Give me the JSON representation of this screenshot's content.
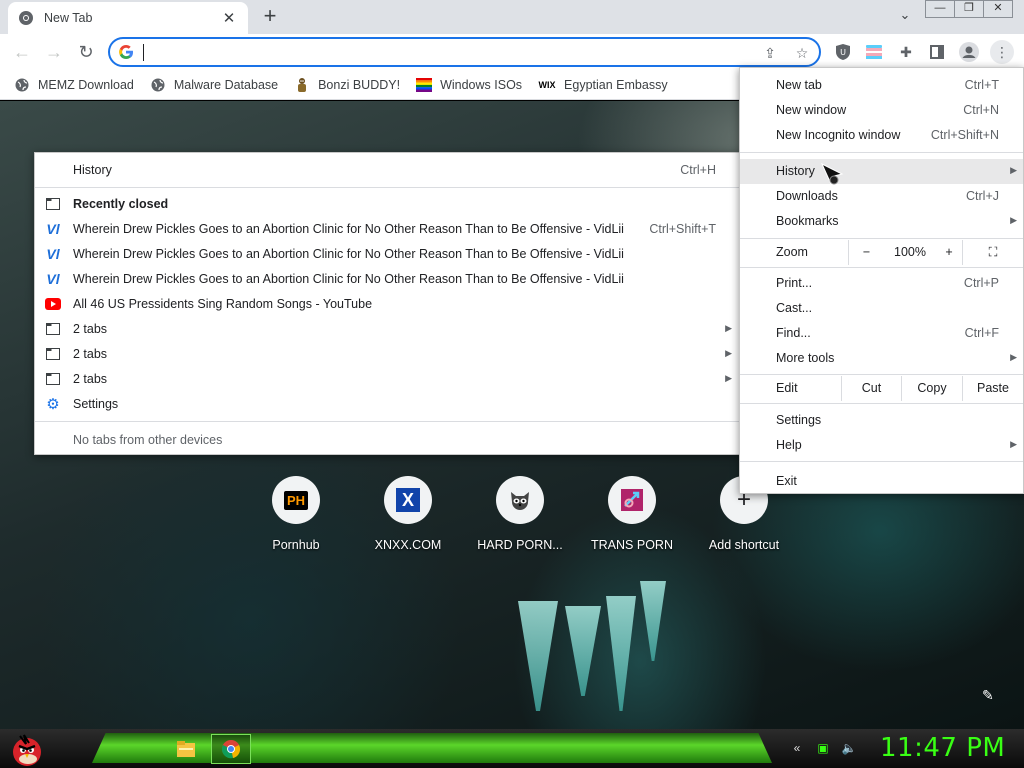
{
  "tab": {
    "title": "New Tab",
    "close": "✕",
    "new": "+"
  },
  "window": {
    "minimize": "—",
    "restore": "❐",
    "close": "✕",
    "dropdown": "⌄"
  },
  "omnibox": {
    "value": "",
    "placeholder": ""
  },
  "bookmarks": [
    {
      "label": "MEMZ Download",
      "icon": "globe-icon"
    },
    {
      "label": "Malware Database",
      "icon": "globe-icon"
    },
    {
      "label": "Bonzi BUDDY!",
      "icon": "bonzi-icon"
    },
    {
      "label": "Windows ISOs",
      "icon": "windows-icon"
    },
    {
      "label": "Egyptian Embassy",
      "icon": "wix-icon"
    }
  ],
  "history_menu": {
    "header": {
      "label": "History",
      "shortcut": "Ctrl+H"
    },
    "recently_closed": "Recently closed",
    "items": [
      {
        "label": "Wherein Drew Pickles Goes to an Abortion Clinic for No Other Reason Than to Be Offensive - VidLii",
        "shortcut": "Ctrl+Shift+T",
        "icon": "vidlii-icon"
      },
      {
        "label": "Wherein Drew Pickles Goes to an Abortion Clinic for No Other Reason Than to Be Offensive - VidLii",
        "shortcut": "",
        "icon": "vidlii-icon"
      },
      {
        "label": "Wherein Drew Pickles Goes to an Abortion Clinic for No Other Reason Than to Be Offensive - VidLii",
        "shortcut": "",
        "icon": "vidlii-icon"
      },
      {
        "label": "All 46 US Pressidents Sing Random Songs - YouTube",
        "shortcut": "",
        "icon": "youtube-icon"
      }
    ],
    "tab_groups": [
      "2 tabs",
      "2 tabs",
      "2 tabs"
    ],
    "settings": "Settings",
    "footer": "No tabs from other devices"
  },
  "chrome_menu": {
    "new_tab": {
      "label": "New tab",
      "shortcut": "Ctrl+T"
    },
    "new_window": {
      "label": "New window",
      "shortcut": "Ctrl+N"
    },
    "new_incognito": {
      "label": "New Incognito window",
      "shortcut": "Ctrl+Shift+N"
    },
    "history": {
      "label": "History"
    },
    "downloads": {
      "label": "Downloads",
      "shortcut": "Ctrl+J"
    },
    "bookmarks": {
      "label": "Bookmarks"
    },
    "zoom": {
      "label": "Zoom",
      "minus": "−",
      "value": "100%",
      "plus": "+"
    },
    "print": {
      "label": "Print...",
      "shortcut": "Ctrl+P"
    },
    "cast": {
      "label": "Cast..."
    },
    "find": {
      "label": "Find...",
      "shortcut": "Ctrl+F"
    },
    "more_tools": {
      "label": "More tools"
    },
    "edit": {
      "label": "Edit",
      "cut": "Cut",
      "copy": "Copy",
      "paste": "Paste"
    },
    "settings": {
      "label": "Settings"
    },
    "help": {
      "label": "Help"
    },
    "exit": {
      "label": "Exit"
    }
  },
  "shortcuts": [
    {
      "label": "Pornhub",
      "icon": "ph-icon",
      "glyph": "PH"
    },
    {
      "label": "XNXX.COM",
      "icon": "x-icon",
      "glyph": "X"
    },
    {
      "label": "HARD PORN...",
      "icon": "raccoon-icon",
      "glyph": ""
    },
    {
      "label": "TRANS PORN",
      "icon": "trans-site-icon",
      "glyph": ""
    },
    {
      "label": "Add shortcut",
      "icon": "plus-icon",
      "glyph": "+"
    }
  ],
  "taskbar": {
    "clock": "11:47 PM"
  },
  "colors": {
    "accent": "#1a73e8",
    "clock": "#39ff14",
    "taskbar_green": "#5bd62a"
  }
}
